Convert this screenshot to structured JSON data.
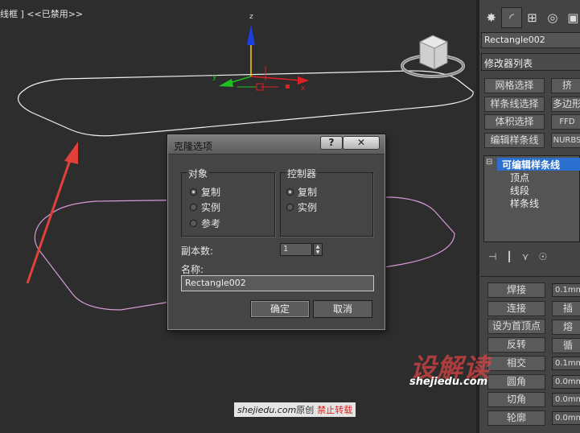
{
  "viewport": {
    "label": "线框 ] <<已禁用>>",
    "axis_labels": {
      "z": "z",
      "x": "x",
      "y": "y"
    }
  },
  "panel": {
    "tabs": [
      "create-icon",
      "modify-icon",
      "hierarchy-icon",
      "motion-icon",
      "display-icon"
    ],
    "object_name": "Rectangle002",
    "modifier_list": "修改器列表",
    "modifier_buttons": [
      "网格选择",
      "挤",
      "样条线选择",
      "多边形",
      "体积选择",
      "FFD",
      "编辑样条线",
      "NURBS"
    ],
    "stack": {
      "selected": "可编辑样条线",
      "items": [
        "顶点",
        "线段",
        "样条线"
      ]
    },
    "geometry_buttons": [
      "焊接",
      "连接",
      "设为首顶点",
      "反转",
      "相交",
      "圆角",
      "切角",
      "轮廓"
    ],
    "geometry_right": [
      "插",
      "熔",
      "循",
      "0.1mm",
      "0.0mm",
      "0.0mm",
      "0.1mm",
      "0.0mm"
    ],
    "geometry_values": [
      "0.1mm",
      "0.1mm",
      "0.0mm",
      "0.0mm",
      "0.0mm"
    ]
  },
  "dialog": {
    "title": "克隆选项",
    "help_label": "?",
    "close_label": "✕",
    "object_group": {
      "title": "对象",
      "options": [
        "复制",
        "实例",
        "参考"
      ],
      "selected": "复制"
    },
    "controller_group": {
      "title": "控制器",
      "options": [
        "复制",
        "实例"
      ],
      "selected": "复制"
    },
    "copies_label": "副本数:",
    "copies_value": "1",
    "name_label": "名称:",
    "name_value": "Rectangle002",
    "ok_label": "确定",
    "cancel_label": "取消"
  },
  "watermark": {
    "brand": "设解读",
    "url": "shejiedu.com",
    "bar_site": "shejiedu.com",
    "bar_original": "原创",
    "bar_notice": "禁止转载"
  },
  "colors": {
    "viewport_bg": "#2d2d2d",
    "selection_blue": "#2b6fcf",
    "arrow_red": "#e0423a",
    "spline_white": "#f2f2f2",
    "spline_pink": "#d69ad6"
  }
}
